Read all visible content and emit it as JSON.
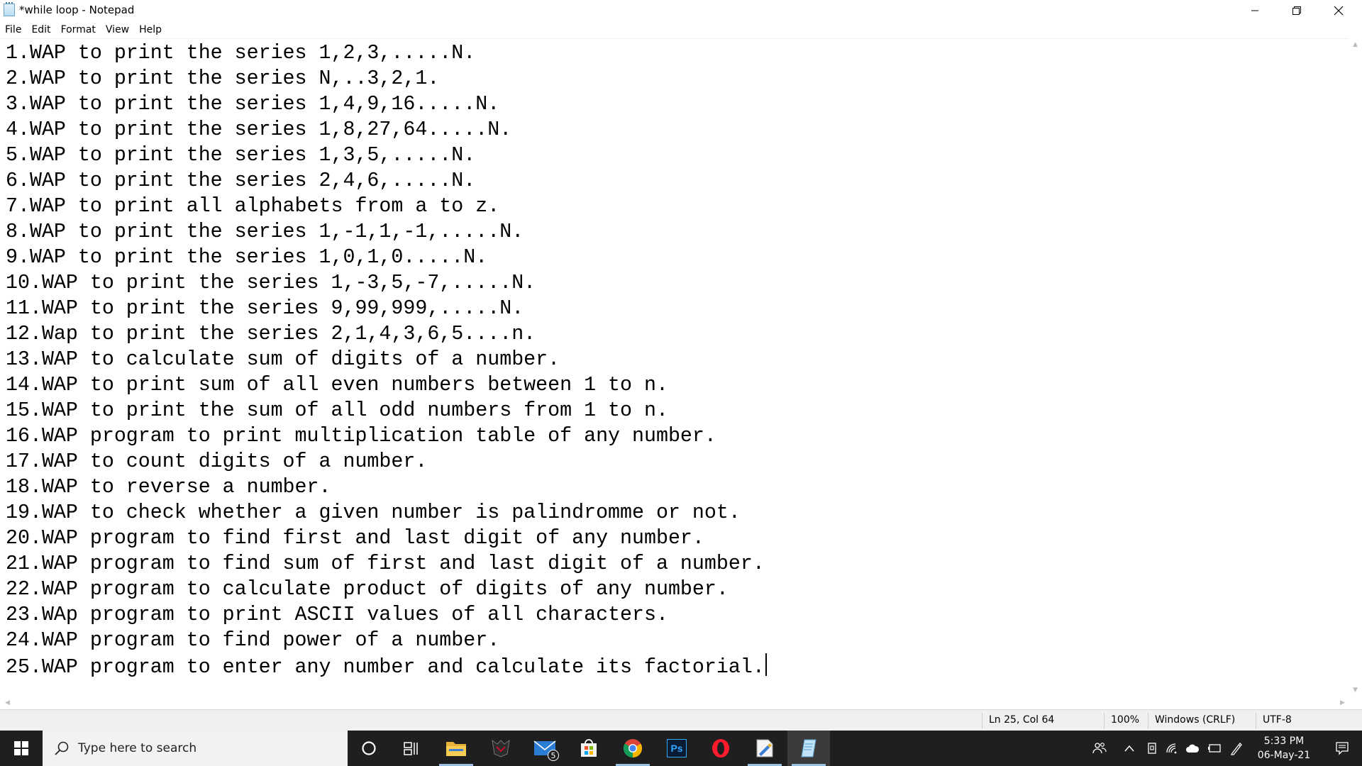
{
  "window": {
    "title": "*while loop - Notepad",
    "icon": "notepad-icon",
    "controls": [
      "minimize-icon",
      "maximize-icon",
      "close-icon"
    ]
  },
  "menu": [
    {
      "label": "File"
    },
    {
      "label": "Edit"
    },
    {
      "label": "Format"
    },
    {
      "label": "View"
    },
    {
      "label": "Help"
    }
  ],
  "editor": {
    "lines": [
      "1.WAP to print the series 1,2,3,.....N.",
      "2.WAP to print the series N,..3,2,1.",
      "3.WAP to print the series 1,4,9,16.....N.",
      "4.WAP to print the series 1,8,27,64.....N.",
      "5.WAP to print the series 1,3,5,.....N.",
      "6.WAP to print the series 2,4,6,.....N.",
      "7.WAP to print all alphabets from a to z.",
      "8.WAP to print the series 1,-1,1,-1,.....N.",
      "9.WAP to print the series 1,0,1,0.....N.",
      "10.WAP to print the series 1,-3,5,-7,.....N.",
      "11.WAP to print the series 9,99,999,.....N.",
      "12.Wap to print the series 2,1,4,3,6,5....n.",
      "13.WAP to calculate sum of digits of a number.",
      "14.WAP to print sum of all even numbers between 1 to n.",
      "15.WAP to print the sum of all odd numbers from 1 to n.",
      "16.WAP program to print multiplication table of any number.",
      "17.WAP to count digits of a number.",
      "18.WAP to reverse a number.",
      "19.WAP to check whether a given number is palindromme or not.",
      "20.WAP program to find first and last digit of any number.",
      "21.WAP program to find sum of first and last digit of a number.",
      "22.WAP program to calculate product of digits of any number.",
      "23.WAp program to print ASCII values of all characters.",
      "24.WAP program to find power of a number.",
      "25.WAP program to enter any number and calculate its factorial."
    ]
  },
  "status": {
    "position": "Ln 25, Col 64",
    "zoom": "100%",
    "line_ending": "Windows (CRLF)",
    "encoding": "UTF-8"
  },
  "taskbar": {
    "search_placeholder": "Type here to search",
    "apps": [
      {
        "name": "cortana-icon"
      },
      {
        "name": "task-view-icon"
      },
      {
        "name": "file-explorer-icon"
      },
      {
        "name": "acer-predator-icon"
      },
      {
        "name": "mail-icon",
        "badge": "5"
      },
      {
        "name": "microsoft-store-icon"
      },
      {
        "name": "chrome-icon"
      },
      {
        "name": "photoshop-icon",
        "text": "Ps"
      },
      {
        "name": "opera-icon"
      },
      {
        "name": "paint-icon"
      },
      {
        "name": "notepad-icon"
      }
    ],
    "clock": {
      "time": "5:33 PM",
      "date": "06-May-21"
    }
  }
}
